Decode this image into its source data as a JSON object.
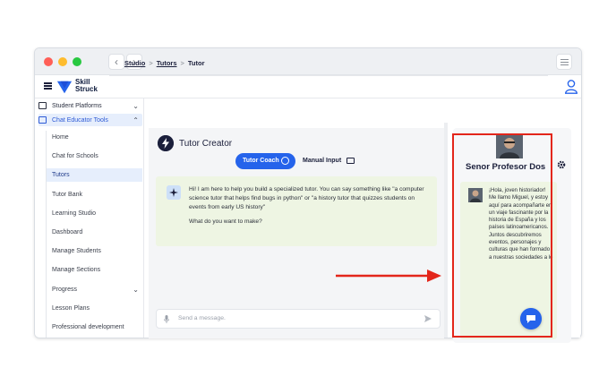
{
  "brand": {
    "logo_line1": "Skill",
    "logo_line2": "Struck"
  },
  "sidebar": {
    "sections": [
      {
        "label": "Student Platforms",
        "icon": "window-icon"
      },
      {
        "label": "Chat Educator Tools",
        "icon": "chat-tools-icon"
      }
    ],
    "items": [
      {
        "label": "Home"
      },
      {
        "label": "Chat for Schools"
      },
      {
        "label": "Tutors"
      },
      {
        "label": "Tutor Bank"
      },
      {
        "label": "Learning Studio"
      },
      {
        "label": "Dashboard"
      },
      {
        "label": "Manage Students"
      },
      {
        "label": "Manage Sections"
      },
      {
        "label": "Progress"
      },
      {
        "label": "Lesson Plans"
      },
      {
        "label": "Professional development"
      }
    ]
  },
  "breadcrumb": {
    "items": [
      "Studio",
      "Tutors",
      "Tutor"
    ]
  },
  "creator": {
    "title": "Tutor Creator",
    "tab_coach": "Tutor Coach",
    "tab_manual": "Manual Input",
    "message_p1": "Hi! I am here to help you build a specialized tutor. You can say something like \"a computer science tutor that helps find bugs in python\" or \"a history tutor that quizzes students on events from early US history\"",
    "message_p2": "What do you want to make?",
    "input_placeholder": "Send a message."
  },
  "preview": {
    "tutor_name": "Senor Profesor Dos",
    "greeting": "¡Hola, joven historiador! Me llamo Miguel, y estoy aquí para acompañarte en un viaje fascinante por la historia de España y los países latinoamericanos. Juntos descubriremos eventos, personajes y culturas que han formado a nuestras sociedades a lo"
  },
  "colors": {
    "accent": "#2563eb",
    "highlight": "#e3261b",
    "message_bg": "#eef5e3"
  }
}
